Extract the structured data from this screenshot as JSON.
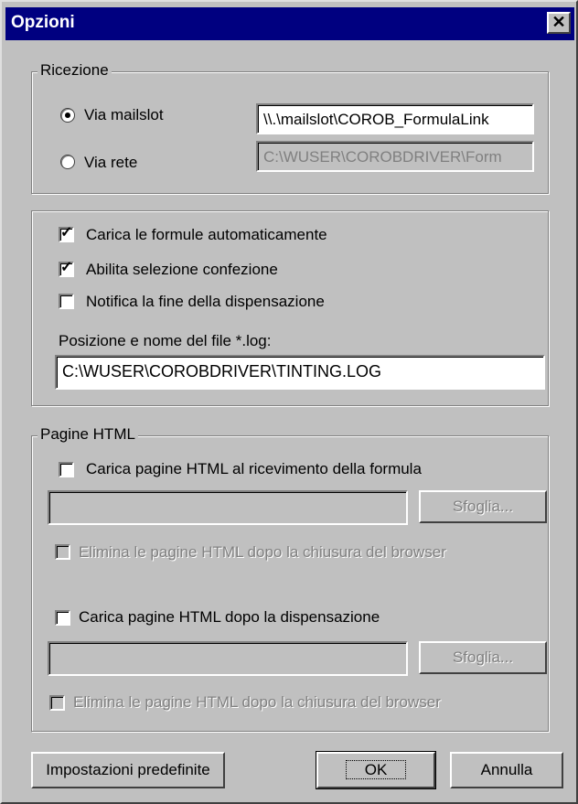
{
  "window": {
    "title": "Opzioni",
    "close_glyph": "✕"
  },
  "ricezione": {
    "legend": "Ricezione",
    "radio_mailslot": {
      "label": "Via mailslot",
      "selected": true
    },
    "mailslot_path": "\\\\.\\mailslot\\COROB_FormulaLink",
    "radio_rete": {
      "label": "Via rete",
      "selected": false
    },
    "rete_path": "C:\\WUSER\\COROBDRIVER\\Form"
  },
  "options": {
    "carica_formule": {
      "label": "Carica le formule automaticamente",
      "checked": true
    },
    "abilita_confezione": {
      "label": "Abilita selezione confezione",
      "checked": true
    },
    "notifica_fine": {
      "label": "Notifica la fine della dispensazione",
      "checked": false
    },
    "log_label": "Posizione e nome del file *.log:",
    "log_path": "C:\\WUSER\\COROBDRIVER\\TINTING.LOG"
  },
  "pagine_html": {
    "legend": "Pagine HTML",
    "carica_ricevimento": {
      "label": "Carica pagine HTML al ricevimento della formula",
      "checked": false
    },
    "ricevimento_path": "",
    "sfoglia_1": "Sfoglia...",
    "elimina_1": "Elimina le pagine HTML dopo la chiusura del browser",
    "carica_dispensazione": {
      "label": "Carica pagine HTML dopo la dispensazione",
      "checked": false
    },
    "dispensazione_path": "",
    "sfoglia_2": "Sfoglia...",
    "elimina_2": "Elimina le pagine HTML dopo la chiusura del browser"
  },
  "buttons": {
    "defaults": "Impostazioni predefinite",
    "ok": "OK",
    "cancel": "Annulla"
  }
}
